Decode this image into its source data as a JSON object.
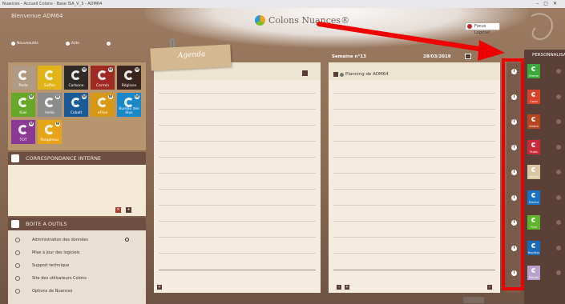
{
  "window": {
    "title": "Nuances - Accueil Colons - Base ISA_V_3 - ADM64"
  },
  "header": {
    "welcome": "Bienvenue   ADM64",
    "brand_name": "Colons Nuances®",
    "focus_button": "Focus Logiciel"
  },
  "quicklinks": [
    {
      "label": "Nouveautés"
    },
    {
      "label": "Aide"
    },
    {
      "label": ""
    }
  ],
  "tiles": [
    {
      "label": "Perle",
      "color": "#b19a84",
      "w": false
    },
    {
      "label": "Saffier",
      "color": "#e1b316",
      "w": false
    },
    {
      "label": "Carbone",
      "color": "#2f2a28",
      "w": true
    },
    {
      "label": "Carmin",
      "color": "#9e2a23",
      "w": true
    },
    {
      "label": "Réglisse",
      "color": "#3a2420",
      "w": true
    },
    {
      "label": "Kiwi",
      "color": "#67a82a",
      "w": true
    },
    {
      "label": "Helio",
      "color": "#8c8c8c",
      "w": true
    },
    {
      "label": "Cobalt",
      "color": "#1a5a96",
      "w": true
    },
    {
      "label": "eFluo",
      "color": "#d89a16",
      "w": true
    },
    {
      "label": "Bureau des élus",
      "color": "#1a88c8",
      "w": true
    },
    {
      "label": "TOT",
      "color": "#8a3a94",
      "w": true
    },
    {
      "label": "Parapheur",
      "color": "#e8a418",
      "w": true
    }
  ],
  "correspondance": {
    "title": "CORRESPONDANCE INTERNE"
  },
  "toolbox": {
    "title": "BOITE A OUTILS",
    "items": [
      {
        "label": "Administration des données"
      },
      {
        "label": "Mise à jour des logiciels"
      },
      {
        "label": "Support technique"
      },
      {
        "label": "Site des utilisateurs Colons"
      },
      {
        "label": "Options de Nuances"
      }
    ]
  },
  "agenda": {
    "title": "Agenda"
  },
  "planning": {
    "week": "Semaine n°13",
    "date": "28/03/2019",
    "title": "Planning de ADM64"
  },
  "personnalisation": {
    "title": "PERSONNALISATION",
    "tiles": [
      {
        "label": "Prisme",
        "color": "#3aa83a"
      },
      {
        "label": "Coral",
        "color": "#d8432a"
      },
      {
        "label": "Ambre",
        "color": "#b7461e"
      },
      {
        "label": "Rubis",
        "color": "#c82a38"
      },
      {
        "label": "Vanille",
        "color": "#d9c6a2"
      },
      {
        "label": "Electra",
        "color": "#1a73c2"
      },
      {
        "label": "Fluo",
        "color": "#5fb52a"
      },
      {
        "label": "Nephtys",
        "color": "#1a6ab8"
      },
      {
        "label": "Mauve",
        "color": "#b8a2cc"
      }
    ]
  },
  "info_icon_count": 9,
  "colors": {
    "highlight": "#ee0000"
  }
}
